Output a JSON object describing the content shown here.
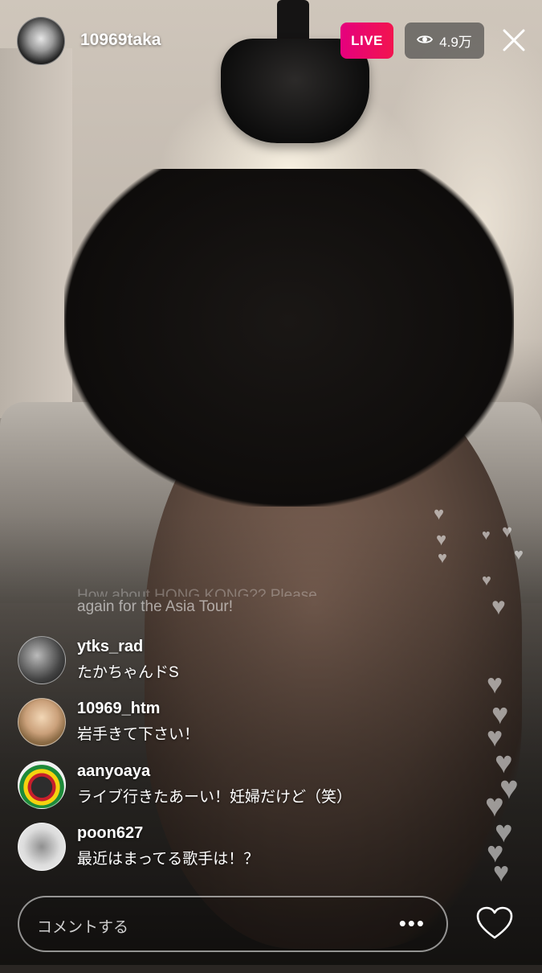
{
  "header": {
    "username": "10969taka",
    "live_label": "LIVE",
    "viewer_count": "4.9万"
  },
  "faded_comment": {
    "line1": "How about HONG KONG?? Please visit HK",
    "line2": "again for the Asia Tour!"
  },
  "comments": [
    {
      "user": "ytks_rad",
      "message": "たかちゃんドS"
    },
    {
      "user": "10969_htm",
      "message": "岩手きて下さい！"
    },
    {
      "user": "aanyoaya",
      "message": "ライブ行きたあーい！妊婦だけど（笑）"
    },
    {
      "user": "poon627",
      "message": "最近はまってる歌手は！？"
    }
  ],
  "input": {
    "placeholder": "コメントする",
    "more": "•••"
  },
  "icons": {
    "eye": "eye-icon",
    "close": "close-icon",
    "heart": "heart-icon",
    "more": "more-dots-icon"
  },
  "colors": {
    "live_badge": "#e5007e",
    "viewer_pill": "#3c3c3c"
  }
}
